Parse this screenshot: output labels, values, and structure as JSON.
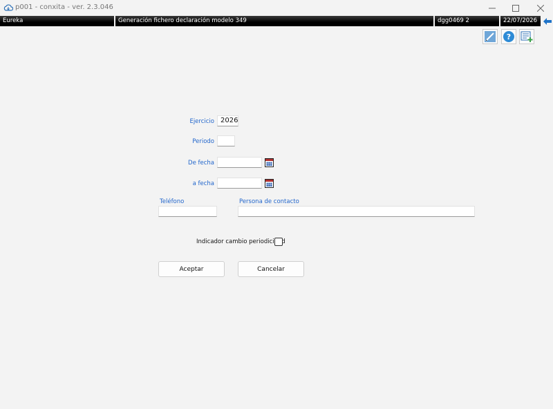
{
  "window": {
    "title": "p001 - conxita - ver. 2.3.046",
    "minimize_icon": "minimize-icon",
    "maximize_icon": "maximize-icon",
    "close_icon": "close-icon"
  },
  "status": {
    "app": "Eureka",
    "program": "Generación fichero declaración modelo 349",
    "user": "dgg0469  2",
    "date": "22/07/2026"
  },
  "toolbar": {
    "edit_icon": "pen-icon",
    "help_icon": "help-icon",
    "list_icon": "list-add-icon"
  },
  "form": {
    "ejercicio_label": "Ejercicio",
    "ejercicio_value": "2026",
    "periodo_label": "Periodo",
    "periodo_value": "",
    "de_fecha_label": "De fecha",
    "de_fecha_value": "",
    "a_fecha_label": "a fecha",
    "a_fecha_value": "",
    "telefono_label": "Teléfono",
    "telefono_value": "",
    "persona_label": "Persona de contacto",
    "persona_value": "",
    "indicador_label": "Indicador cambio periodicidad",
    "indicador_checked": false
  },
  "buttons": {
    "accept": "Aceptar",
    "cancel": "Cancelar"
  },
  "colors": {
    "label_blue": "#2266cc",
    "status_bg": "#000000",
    "window_bg": "#f3f3f3"
  }
}
